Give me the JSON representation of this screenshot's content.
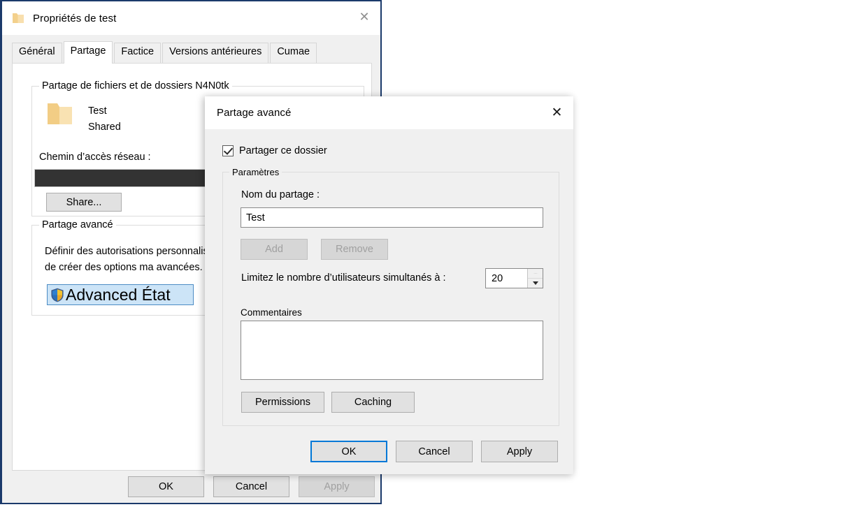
{
  "properties_window": {
    "title": "Propriétés de test",
    "title_icon": "folder-icon",
    "close_icon": "close-icon",
    "tabs": [
      {
        "label": "Général",
        "active": false
      },
      {
        "label": "Partage",
        "active": true
      },
      {
        "label": "Factice",
        "active": false
      },
      {
        "label": "Versions antérieures",
        "active": false
      },
      {
        "label": "Cumae",
        "active": false
      }
    ],
    "file_sharing_group": {
      "legend": "Partage de fichiers et de dossiers N4N0tk",
      "folder_icon": "folder-icon",
      "share_name": "Test",
      "share_status": "Shared",
      "network_path_label": "Chemin d’accès réseau :",
      "network_path_value": "",
      "share_button": "Share..."
    },
    "advanced_sharing_group": {
      "legend": "Partage avancé",
      "description_line1": "Définir des autorisations personnalisées permet",
      "description_line2": "de créer des options ma avancées.",
      "advanced_button": "Advanced État",
      "advanced_button_icon": "uac-shield-icon"
    },
    "footer": {
      "ok": "OK",
      "cancel": "Cancel",
      "apply": "Apply",
      "apply_disabled": true
    }
  },
  "advanced_sharing_window": {
    "title": "Partage avancé",
    "close_icon": "close-icon",
    "share_this_folder": {
      "label": "Partager ce dossier",
      "checked": true
    },
    "settings_group": {
      "legend": "Paramètres",
      "share_name_label": "Nom du partage :",
      "share_name_value": "Test",
      "add_button": "Add",
      "add_disabled": true,
      "remove_button": "Remove",
      "remove_disabled": true,
      "limit_label": "Limitez le nombre d’utilisateurs simultanés à :",
      "limit_value": "20",
      "comments_label": "Commentaires",
      "comments_value": "",
      "permissions_button": "Permissions",
      "caching_button": "Caching"
    },
    "footer": {
      "ok": "OK",
      "cancel": "Cancel",
      "apply": "Apply",
      "ok_is_default": true
    }
  },
  "colors": {
    "window_border": "#1b3a6b",
    "dialog_face": "#f0f0f0",
    "focus_blue": "#0078d7",
    "redaction": "#333333",
    "folder_yellow": "#f5d28a"
  }
}
